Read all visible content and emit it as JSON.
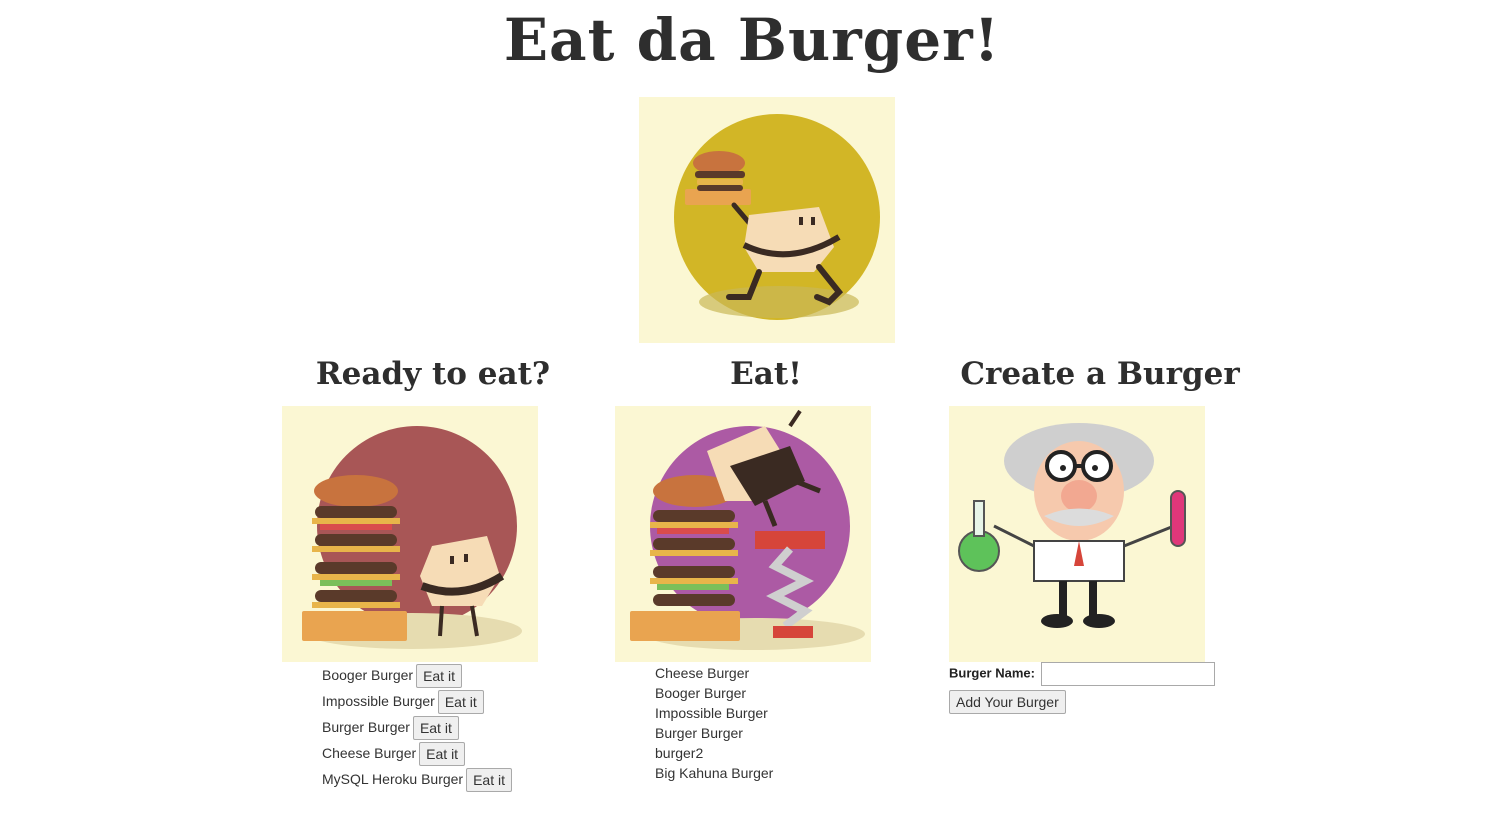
{
  "title": "Eat da Burger!",
  "columns": {
    "ready": {
      "heading": "Ready to eat?"
    },
    "eaten": {
      "heading": "Eat!"
    },
    "create": {
      "heading": "Create a Burger"
    }
  },
  "ready_burgers": [
    {
      "name": "Booger Burger",
      "button": "Eat it"
    },
    {
      "name": "Impossible Burger",
      "button": "Eat it"
    },
    {
      "name": "Burger Burger",
      "button": "Eat it"
    },
    {
      "name": "Cheese Burger",
      "button": "Eat it"
    },
    {
      "name": "MySQL Heroku Burger",
      "button": "Eat it"
    }
  ],
  "eaten_burgers": [
    "Cheese Burger",
    "Booger Burger",
    "Impossible Burger",
    "Burger Burger",
    "burger2",
    "Big Kahuna Burger"
  ],
  "form": {
    "label": "Burger Name:",
    "value": "",
    "submit": "Add Your Burger"
  },
  "colors": {
    "image_bg": "#fbf7d3",
    "hero_circle": "#d2b626",
    "ready_circle": "#a85656",
    "eat_circle": "#ac5aa4",
    "heading": "#2e2e2e"
  },
  "icons": {
    "hero": "burger-character-carrying-burger",
    "ready": "giant-burger-stack-with-character",
    "eat": "character-jumping-on-burger",
    "create": "mad-scientist-with-test-tubes"
  }
}
